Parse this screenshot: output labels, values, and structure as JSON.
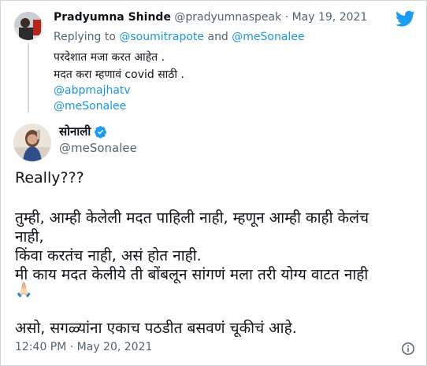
{
  "reply": {
    "name": "Pradyumna Shinde",
    "handle": "@pradyumnaspeak",
    "dot": "·",
    "date": "May 19, 2021",
    "replying_prefix": "Replying to",
    "replying_to_1": "@soumitrapote",
    "replying_and": "and",
    "replying_to_2": "@meSonalee",
    "lines": [
      "परदेशात मजा करत आहेत .",
      "मदत करा म्हणावं covid साठी ."
    ],
    "links": [
      "@abpmajhatv",
      "@meSonalee"
    ]
  },
  "tweet": {
    "name": "सोनाली",
    "handle": "@meSonalee",
    "lines": [
      "Really???",
      "तुम्ही, आम्ही केलेली मदत पाहिली नाही, म्हणून आम्ही काही केलंच",
      "नाही,",
      "किंवा करतंच नाही, असं होत नाही.",
      "मी काय मदत केलीये ती बोंबलून सांगणं मला तरी योग्य वाटत नाही",
      "असो, सगळ्यांना एकाच पठडीत बसवणं चूकीचं आहे."
    ],
    "emoji": "🙏🏻",
    "timestamp": "12:40 PM · May 20, 2021"
  },
  "colors": {
    "link": "#1b95e0",
    "secondary_text": "#536471",
    "verified": "#1d9bf0",
    "twitter_brand": "#1d9bf0"
  },
  "icons": [
    "twitter-bird-icon",
    "verified-badge-icon",
    "info-icon"
  ]
}
